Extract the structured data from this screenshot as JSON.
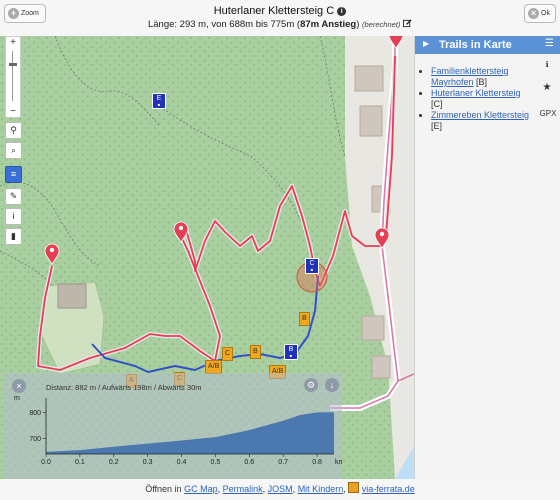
{
  "header": {
    "title": "Huterlaner Klettersteig C",
    "subtitle_pre": "Länge: 293 m, von 688m bis 775m (",
    "subtitle_bold": "87m Anstieg",
    "subtitle_post": ")",
    "subtitle_note": "(berechnet)",
    "zoom_label": "Zoom",
    "ok_label": "Ok"
  },
  "map": {
    "labels": {
      "start_a": "E",
      "marker_c": "C",
      "b1": "B",
      "b2": "B",
      "b3": "B",
      "c1": "C",
      "c2": "C",
      "ab1": "A/B",
      "ab2": "A/B",
      "a1": "A"
    },
    "colors": {
      "forest": "#a9cfa0",
      "route": "#e43f52",
      "trail": "#3450c8",
      "river": "#bcdff6"
    }
  },
  "sidebar": {
    "title": "Trails in Karte",
    "items": [
      {
        "link": "Familienklettersteig Mayrhofen",
        "grade": "[B]"
      },
      {
        "link": "Huterlaner Klettersteig",
        "grade": ""
      },
      {
        "link": "",
        "grade": "[C]"
      },
      {
        "link": "Zimmereben Klettersteig",
        "grade": "[E]"
      }
    ],
    "gpx_label": "GPX"
  },
  "profile": {
    "title": "Distanz: 882 m / Aufwärts 198m / Abwärts 30m",
    "y_unit": "m",
    "x_unit": "km",
    "y_ticks": [
      "800",
      "700"
    ],
    "x_ticks": [
      "0.0",
      "0.1",
      "0.2",
      "0.3",
      "0.4",
      "0.5",
      "0.6",
      "0.7",
      "0.8"
    ]
  },
  "footer": {
    "prefix": "Öffnen in",
    "link1": "GC Map",
    "link2": "Permalink",
    "link3": "JOSM",
    "link4": "Mit Kindern",
    "link5": "via-ferrata.de"
  },
  "chart_data": {
    "type": "area",
    "x": [
      0.0,
      0.1,
      0.2,
      0.3,
      0.4,
      0.5,
      0.6,
      0.7,
      0.75,
      0.8,
      0.85
    ],
    "series": [
      {
        "values": [
          648,
          655,
          668,
          680,
          692,
          705,
          732,
          768,
          790,
          800,
          800
        ]
      }
    ],
    "xlabel": "km",
    "ylabel": "m",
    "xlim": [
      0,
      0.85
    ],
    "ylim": [
      640,
      840
    ]
  }
}
